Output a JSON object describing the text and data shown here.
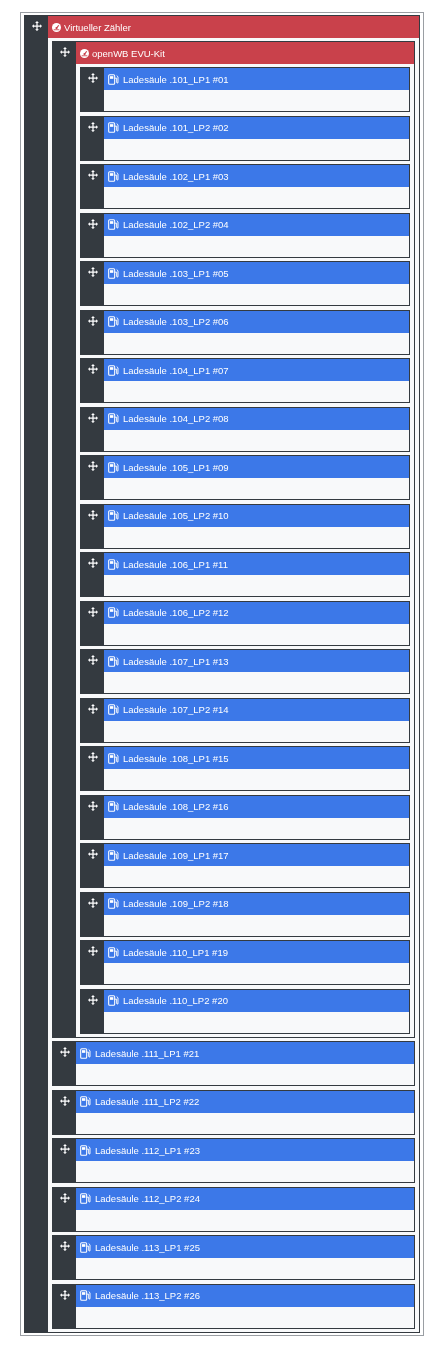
{
  "tree": [
    {
      "kind": "meter",
      "label": "Virtueller Zähler",
      "children": [
        {
          "kind": "meter",
          "label": "openWB EVU-Kit",
          "children": [
            {
              "kind": "chargepoint",
              "label": "Ladesäule .101_LP1 #01"
            },
            {
              "kind": "chargepoint",
              "label": "Ladesäule .101_LP2 #02"
            },
            {
              "kind": "chargepoint",
              "label": "Ladesäule .102_LP1 #03"
            },
            {
              "kind": "chargepoint",
              "label": "Ladesäule .102_LP2 #04"
            },
            {
              "kind": "chargepoint",
              "label": "Ladesäule .103_LP1 #05"
            },
            {
              "kind": "chargepoint",
              "label": "Ladesäule .103_LP2 #06"
            },
            {
              "kind": "chargepoint",
              "label": "Ladesäule .104_LP1 #07"
            },
            {
              "kind": "chargepoint",
              "label": "Ladesäule .104_LP2 #08"
            },
            {
              "kind": "chargepoint",
              "label": "Ladesäule .105_LP1 #09"
            },
            {
              "kind": "chargepoint",
              "label": "Ladesäule .105_LP2 #10"
            },
            {
              "kind": "chargepoint",
              "label": "Ladesäule .106_LP1 #11"
            },
            {
              "kind": "chargepoint",
              "label": "Ladesäule .106_LP2 #12"
            },
            {
              "kind": "chargepoint",
              "label": "Ladesäule .107_LP1 #13"
            },
            {
              "kind": "chargepoint",
              "label": "Ladesäule .107_LP2 #14"
            },
            {
              "kind": "chargepoint",
              "label": "Ladesäule .108_LP1 #15"
            },
            {
              "kind": "chargepoint",
              "label": "Ladesäule .108_LP2 #16"
            },
            {
              "kind": "chargepoint",
              "label": "Ladesäule .109_LP1 #17"
            },
            {
              "kind": "chargepoint",
              "label": "Ladesäule .109_LP2 #18"
            },
            {
              "kind": "chargepoint",
              "label": "Ladesäule .110_LP1 #19"
            },
            {
              "kind": "chargepoint",
              "label": "Ladesäule .110_LP2 #20"
            }
          ]
        },
        {
          "kind": "chargepoint",
          "label": "Ladesäule .111_LP1 #21"
        },
        {
          "kind": "chargepoint",
          "label": "Ladesäule .111_LP2 #22"
        },
        {
          "kind": "chargepoint",
          "label": "Ladesäule .112_LP1 #23"
        },
        {
          "kind": "chargepoint",
          "label": "Ladesäule .112_LP2 #24"
        },
        {
          "kind": "chargepoint",
          "label": "Ladesäule .113_LP1 #25"
        },
        {
          "kind": "chargepoint",
          "label": "Ladesäule .113_LP2 #26"
        }
      ]
    }
  ]
}
